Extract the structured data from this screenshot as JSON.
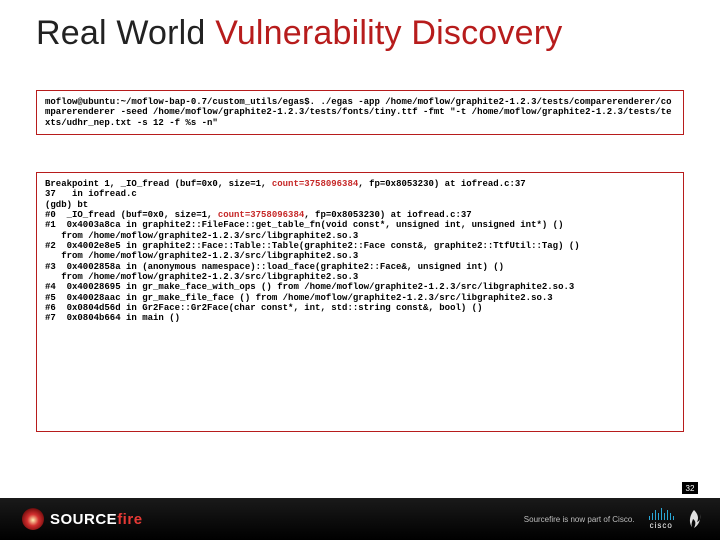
{
  "title_prefix": "Real World",
  "title_accent": "Vulnerability Discovery",
  "code1": "moflow@ubuntu:~/moflow-bap-0.7/custom_utils/egas$. ./egas -app /home/moflow/graphite2-1.2.3/tests/comparerenderer/comparerenderer -seed /home/moflow/graphite2-1.2.3/tests/fonts/tiny.ttf -fmt \"-t /home/moflow/graphite2-1.2.3/tests/texts/udhr_nep.txt -s 12 -f %s -n\"",
  "code2_pre": "Breakpoint 1, _IO_fread (buf=0x0, size=1, ",
  "code2_hl1": "count=3758096384",
  "code2_mid1": ", fp=0x8053230) at iofread.c:37\n37   in iofread.c\n(gdb) bt\n#0  _IO_fread (buf=0x0, size=1, ",
  "code2_hl2": "count=3758096384",
  "code2_post": ", fp=0x8053230) at iofread.c:37\n#1  0x4003a8ca in graphite2::FileFace::get_table_fn(void const*, unsigned int, unsigned int*) ()\n   from /home/moflow/graphite2-1.2.3/src/libgraphite2.so.3\n#2  0x4002e8e5 in graphite2::Face::Table::Table(graphite2::Face const&, graphite2::TtfUtil::Tag) ()\n   from /home/moflow/graphite2-1.2.3/src/libgraphite2.so.3\n#3  0x4002858a in (anonymous namespace)::load_face(graphite2::Face&, unsigned int) ()\n   from /home/moflow/graphite2-1.2.3/src/libgraphite2.so.3\n#4  0x40028695 in gr_make_face_with_ops () from /home/moflow/graphite2-1.2.3/src/libgraphite2.so.3\n#5  0x40028aac in gr_make_file_face () from /home/moflow/graphite2-1.2.3/src/libgraphite2.so.3\n#6  0x0804d56d in Gr2Face::Gr2Face(char const*, int, std::string const&, bool) ()\n#7  0x0804b664 in main ()",
  "footer": {
    "brand_a": "SOURCE",
    "brand_b": "fire",
    "tagline": "Sourcefire is now part of Cisco.",
    "cisco": "cisco",
    "page": "32"
  },
  "cisco_bars": [
    4,
    7,
    10,
    7,
    12,
    7,
    10,
    7,
    4
  ]
}
